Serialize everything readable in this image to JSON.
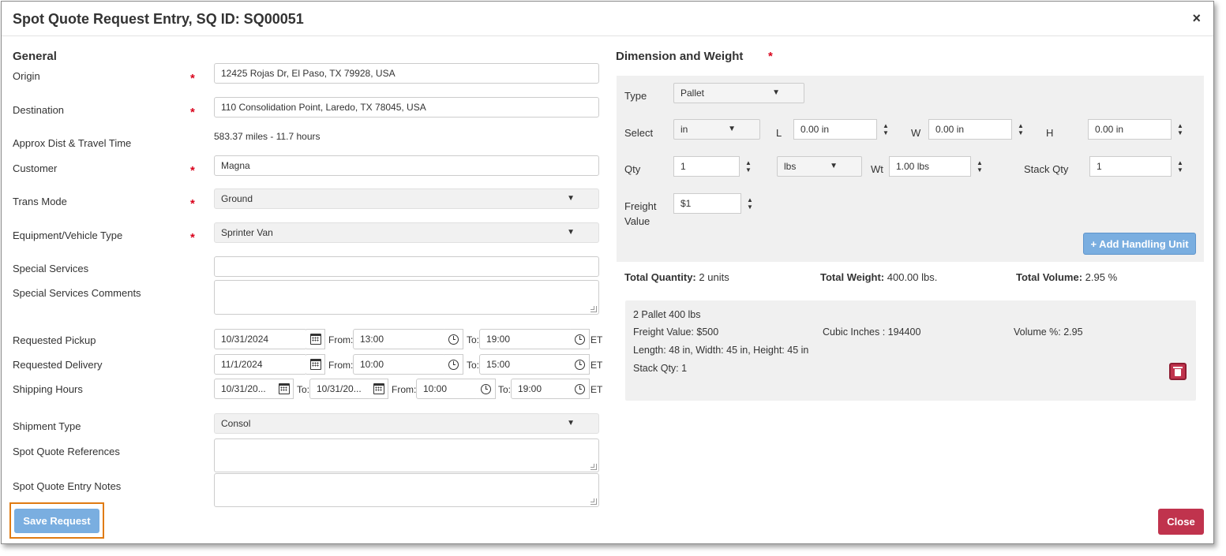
{
  "header": {
    "title": "Spot Quote Request Entry, SQ ID: SQ00051",
    "close_glyph": "×"
  },
  "general": {
    "section_title": "General",
    "origin": {
      "label": "Origin",
      "value": "12425 Rojas Dr, El Paso, TX 79928, USA",
      "required": "*"
    },
    "destination": {
      "label": "Destination",
      "value": "110 Consolidation Point, Laredo, TX 78045, USA",
      "required": "*"
    },
    "distance": {
      "label": "Approx Dist & Travel Time",
      "value": "583.37 miles - 11.7 hours"
    },
    "customer": {
      "label": "Customer",
      "value": "Magna",
      "required": "*"
    },
    "trans_mode": {
      "label": "Trans Mode",
      "value": "Ground",
      "required": "*"
    },
    "equipment": {
      "label": "Equipment/Vehicle Type",
      "value": "Sprinter Van",
      "required": "*"
    },
    "special_services": {
      "label": "Special Services",
      "value": ""
    },
    "special_services_comments": {
      "label": "Special Services Comments",
      "value": ""
    },
    "requested_pickup": {
      "label": "Requested Pickup",
      "date": "10/31/2024",
      "from_label": "From:",
      "from": "13:00",
      "to_label": "To:",
      "to": "19:00",
      "tz": "ET"
    },
    "requested_delivery": {
      "label": "Requested Delivery",
      "date": "11/1/2024",
      "from_label": "From:",
      "from": "10:00",
      "to_label": "To:",
      "to": "15:00",
      "tz": "ET"
    },
    "shipping_hours": {
      "label": "Shipping Hours",
      "date_from": "10/31/20...",
      "to_label": "To:",
      "date_to": "10/31/20...",
      "from_label": "From:",
      "from": "10:00",
      "to_label2": "To:",
      "to": "19:00",
      "tz": "ET"
    },
    "shipment_type": {
      "label": "Shipment Type",
      "value": "Consol"
    },
    "references": {
      "label": "Spot Quote References",
      "value": ""
    },
    "notes": {
      "label": "Spot Quote Entry Notes",
      "value": ""
    }
  },
  "dimension": {
    "section_title": "Dimension and Weight",
    "required": "*",
    "type_label": "Type",
    "type_value": "Pallet",
    "select_label": "Select",
    "unit_value": "in",
    "l_label": "L",
    "l_value": "0.00 in",
    "w_label": "W",
    "w_value": "0.00 in",
    "h_label": "H",
    "h_value": "0.00 in",
    "qty_label": "Qty",
    "qty_value": "1",
    "weight_unit": "lbs",
    "wt_label": "Wt",
    "wt_value": "1.00 lbs",
    "stack_label": "Stack Qty",
    "stack_value": "1",
    "freight_label_1": "Freight",
    "freight_label_2": "Value",
    "freight_value": "$1",
    "add_button": "+ Add Handling Unit",
    "totals": {
      "qty_label": "Total Quantity:",
      "qty_value": "2 units",
      "weight_label": "Total Weight:",
      "weight_value": "400.00 lbs.",
      "volume_label": "Total Volume:",
      "volume_value": "2.95 %"
    },
    "unit_card": {
      "line1": "2 Pallet 400 lbs",
      "freight_value": "Freight Value: $500",
      "cubic": "Cubic Inches : 194400",
      "volume": "Volume %: 2.95",
      "dims": "Length: 48 in, Width: 45 in, Height: 45 in",
      "stack": "Stack Qty: 1"
    }
  },
  "footer": {
    "save_label": "Save Request",
    "close_label": "Close"
  },
  "glyphs": {
    "caret": "▼",
    "up": "▲",
    "down": "▼"
  },
  "colors": {
    "required": "#d9001b",
    "primary": "#7aaee0",
    "danger": "#c0334d",
    "highlight": "#e07b12"
  }
}
